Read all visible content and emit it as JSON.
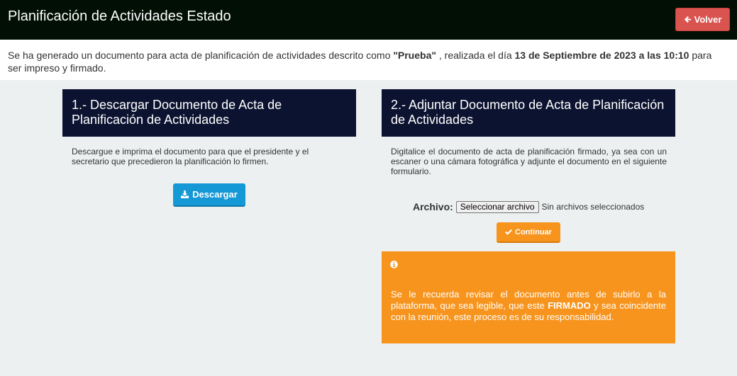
{
  "header": {
    "title": "Planificación de Actividades Estado",
    "back_label": "Volver"
  },
  "intro": {
    "part1": "Se ha generado un documento para acta de planificación de actividades descrito como ",
    "doc_name": "\"Prueba\"",
    "part2": " , realizada el día ",
    "date": "13 de Septiembre de 2023 a las 10:10",
    "part3": " para ser impreso y firmado."
  },
  "download_panel": {
    "title": "1.- Descargar Documento de Acta de Planificación de Actividades",
    "text": "Descargue e imprima el documento para que el presidente y el secretario que precedieron la planificación lo firmen.",
    "button_label": "Descargar"
  },
  "upload_panel": {
    "title": "2.- Adjuntar Documento de Acta de Planificación de Actividades",
    "text": "Digitalice el documento de acta de planificación firmado, ya sea con un escaner o una cámara fotográfica y adjunte el documento en el siguiente formulario.",
    "file_label": "Archivo:",
    "file_button": "Seleccionar archivo",
    "file_status": "Sin archivos seleccionados",
    "continue_label": "Continuar"
  },
  "alert": {
    "icon": "info-circle-icon",
    "part1": "Se le recuerda revisar el documento antes de subirlo a la plataforma, que sea legible, que este ",
    "emphasis": "FIRMADO",
    "part2": " y sea coincidente con la reunión, este proceso es de su responsabilidad."
  },
  "colors": {
    "header_bg": "#010f04",
    "panel_head_bg": "#0c1330",
    "danger": "#d9534f",
    "primary": "#1598d6",
    "warning": "#f7941d",
    "page_bg": "#ecf0f1"
  }
}
